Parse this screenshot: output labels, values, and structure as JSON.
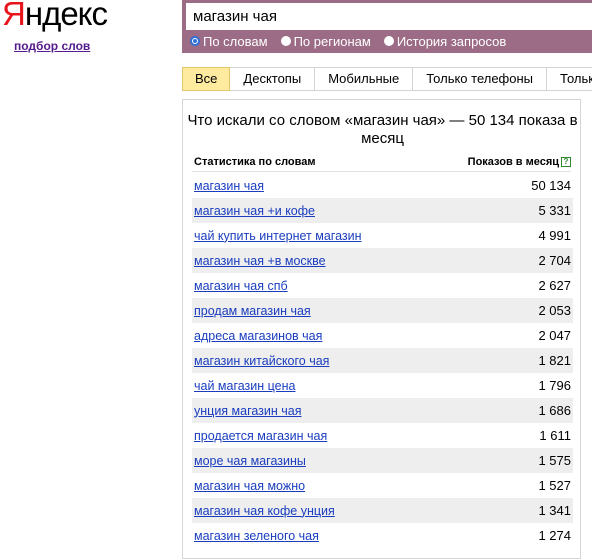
{
  "logo": {
    "first_letter": "Я",
    "rest": "ндекс"
  },
  "subtitle_link": "подбор слов",
  "search": {
    "value": "магазин чая"
  },
  "search_mode": [
    {
      "label": "По словам",
      "checked": true
    },
    {
      "label": "По регионам",
      "checked": false
    },
    {
      "label": "История запросов",
      "checked": false
    }
  ],
  "tabs": [
    {
      "label": "Все",
      "active": true
    },
    {
      "label": "Десктопы",
      "active": false
    },
    {
      "label": "Мобильные",
      "active": false
    },
    {
      "label": "Только телефоны",
      "active": false
    },
    {
      "label": "Только",
      "active": false
    }
  ],
  "stats": {
    "title": "Что искали со словом «магазин чая» — 50 134 показа в месяц",
    "col_left": "Статистика по словам",
    "col_right": "Показов в месяц",
    "rows": [
      {
        "phrase": "магазин чая",
        "count": "50 134"
      },
      {
        "phrase": "магазин чая +и кофе",
        "count": "5 331"
      },
      {
        "phrase": "чай купить интернет магазин",
        "count": "4 991"
      },
      {
        "phrase": "магазин чая +в москве",
        "count": "2 704"
      },
      {
        "phrase": "магазин чая спб",
        "count": "2 627"
      },
      {
        "phrase": "продам магазин чая",
        "count": "2 053"
      },
      {
        "phrase": "адреса магазинов чая",
        "count": "2 047"
      },
      {
        "phrase": "магазин китайского чая",
        "count": "1 821"
      },
      {
        "phrase": "чай магазин цена",
        "count": "1 796"
      },
      {
        "phrase": "унция магазин чая",
        "count": "1 686"
      },
      {
        "phrase": "продается магазин чая",
        "count": "1 611"
      },
      {
        "phrase": "море чая магазины",
        "count": "1 575"
      },
      {
        "phrase": "магазин чая можно",
        "count": "1 527"
      },
      {
        "phrase": "магазин чая кофе унция",
        "count": "1 341"
      },
      {
        "phrase": "магазин зеленого чая",
        "count": "1 274"
      }
    ]
  },
  "colors": {
    "logo_red": "#e8141c",
    "header_bg": "#9c6c86",
    "active_tab": "#ffeba0",
    "link": "#1a3dbf",
    "visited_link": "#551a8b"
  }
}
